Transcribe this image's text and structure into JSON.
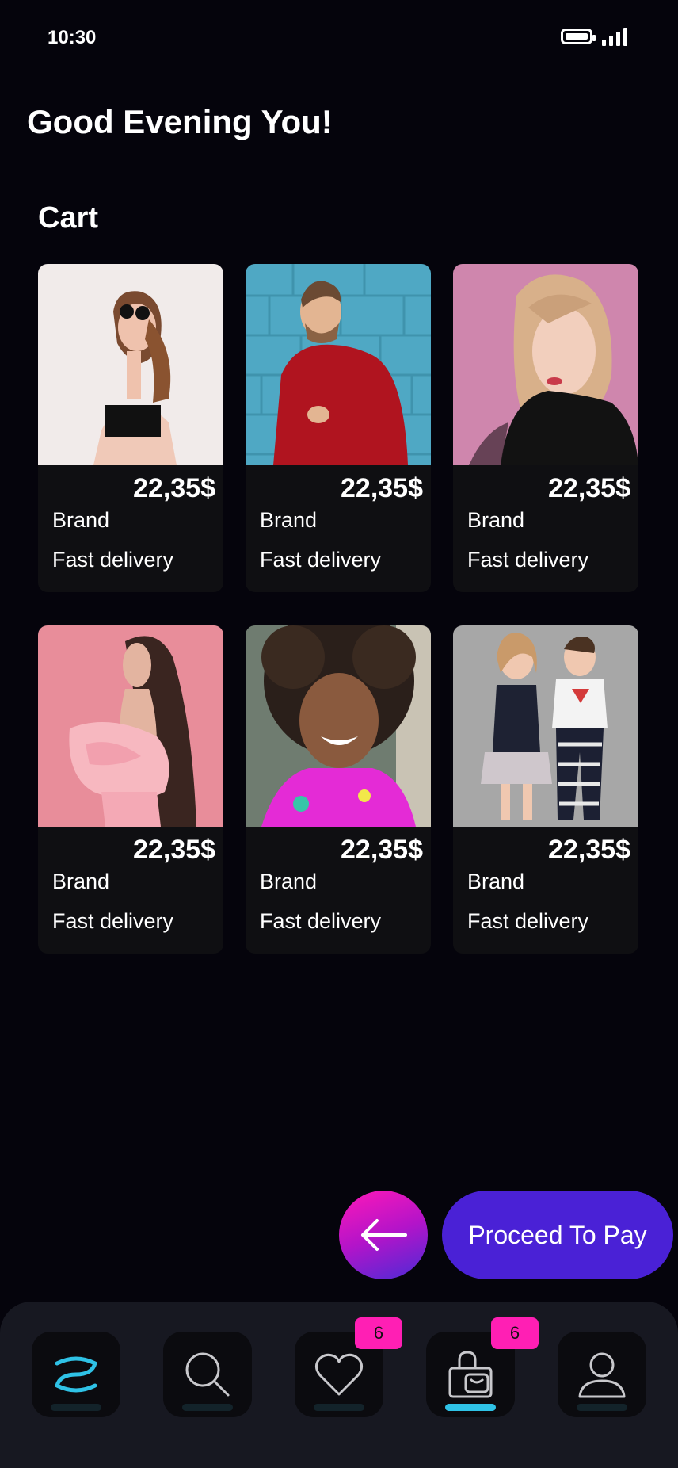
{
  "status": {
    "time": "10:30",
    "icons": [
      "battery-icon",
      "signal-icon"
    ]
  },
  "greeting": "Good Evening You!",
  "cart": {
    "title": "Cart",
    "items": [
      {
        "price": "22,35$",
        "brand": "Brand",
        "delivery": "Fast delivery",
        "image": "woman-sunglasses-photo"
      },
      {
        "price": "22,35$",
        "brand": "Brand",
        "delivery": "Fast delivery",
        "image": "man-red-sweater-photo"
      },
      {
        "price": "22,35$",
        "brand": "Brand",
        "delivery": "Fast delivery",
        "image": "woman-black-scarf-photo"
      },
      {
        "price": "22,35$",
        "brand": "Brand",
        "delivery": "Fast delivery",
        "image": "woman-pink-dress-photo"
      },
      {
        "price": "22,35$",
        "brand": "Brand",
        "delivery": "Fast delivery",
        "image": "girl-pink-top-photo"
      },
      {
        "price": "22,35$",
        "brand": "Brand",
        "delivery": "Fast delivery",
        "image": "kids-outfits-photo"
      }
    ]
  },
  "actions": {
    "back_icon": "arrow-left-icon",
    "proceed_label": "Proceed To Pay"
  },
  "nav": {
    "items": [
      {
        "name": "home",
        "icon": "logo-icon",
        "active": true
      },
      {
        "name": "search",
        "icon": "search-icon",
        "active": false
      },
      {
        "name": "favorites",
        "icon": "heart-icon",
        "badge": "6",
        "active": false
      },
      {
        "name": "cart",
        "icon": "shopping-bag-icon",
        "badge": "6",
        "active": false
      },
      {
        "name": "profile",
        "icon": "user-icon",
        "active": false
      }
    ]
  },
  "colors": {
    "background": "#05040c",
    "accent": "#4a21d6",
    "badge": "#ff1fb4",
    "active": "#2fc2e6"
  }
}
